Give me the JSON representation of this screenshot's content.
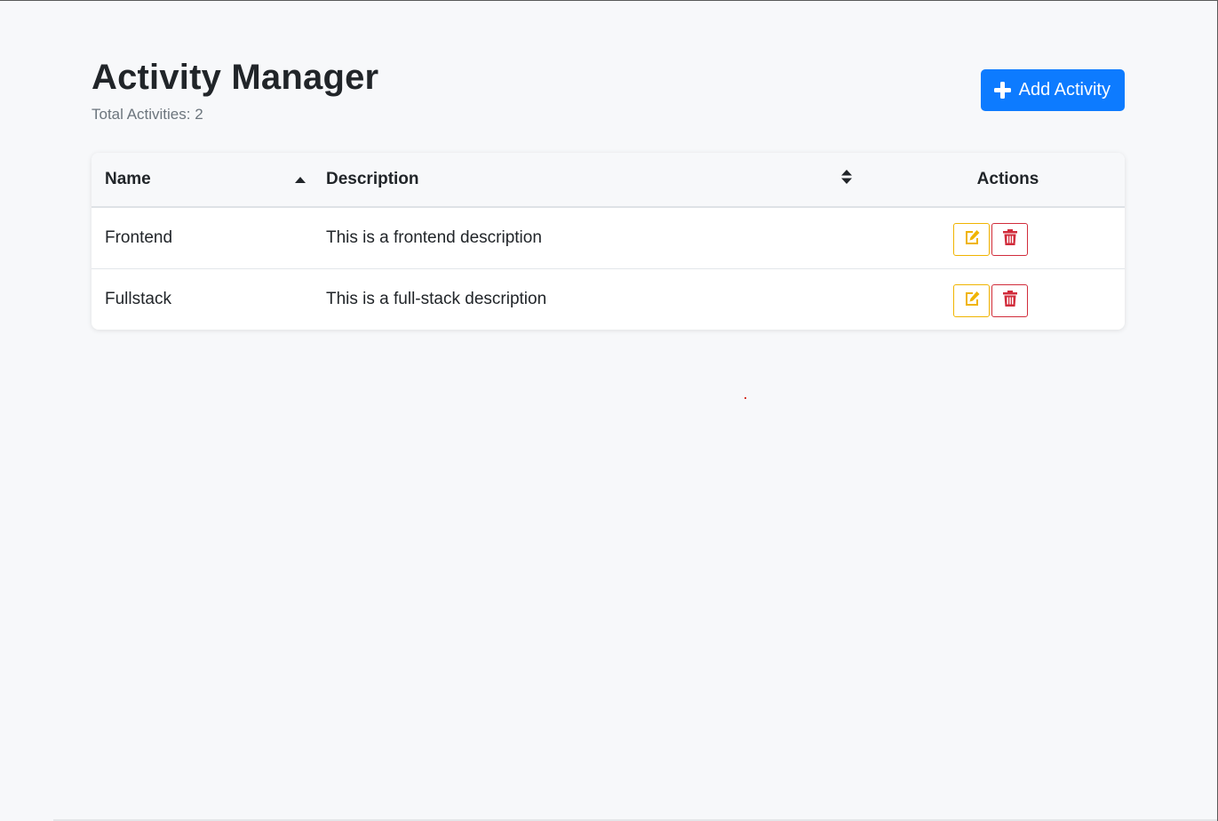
{
  "header": {
    "title": "Activity Manager",
    "subtitle": "Total Activities: 2",
    "add_button_label": "Add Activity"
  },
  "table": {
    "columns": [
      "Name",
      "Description",
      "Actions"
    ],
    "rows": [
      {
        "name": "Frontend",
        "description": "This is a frontend description"
      },
      {
        "name": "Fullstack",
        "description": "This is a full-stack description"
      }
    ]
  },
  "icons": {
    "add": "plus-icon",
    "name_sort": "sort-asc-icon",
    "description_sort": "sort-icon",
    "edit": "edit-icon",
    "delete": "trash-icon"
  },
  "colors": {
    "primary": "#0d7bff",
    "warning": "#f0b400",
    "danger": "#d12c3b",
    "background": "#f7f8fa"
  }
}
